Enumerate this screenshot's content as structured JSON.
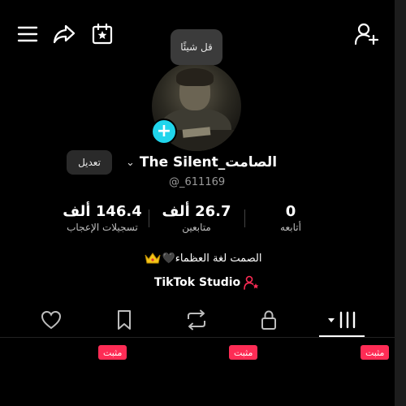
{
  "header": {
    "icons": [
      "menu-icon",
      "share-icon",
      "calendar-icon",
      "add-user-icon"
    ]
  },
  "profile": {
    "note_bubble": "قل شيئًا",
    "edit_label": "تعديل",
    "display_name": "الصامت_The Silent",
    "username": "@_611169",
    "bio_text": "الصمت لغة العظماء🖤",
    "studio_label": "TikTok Studio"
  },
  "stats": {
    "following": {
      "value": "0",
      "label": "أتابعه"
    },
    "followers": {
      "value": "26.7 ألف",
      "label": "متابعين"
    },
    "likes": {
      "value": "146.4 ألف",
      "label": "تسجيلات الإعجاب"
    }
  },
  "tabs": {
    "active": "videos",
    "items": [
      "videos",
      "private",
      "reposts",
      "favorites",
      "liked"
    ]
  },
  "grid": {
    "pinned_label": "مثبت"
  },
  "colors": {
    "accent_cyan": "#20d5ec",
    "pinned_badge": "#fe2c55",
    "background": "#000000"
  }
}
